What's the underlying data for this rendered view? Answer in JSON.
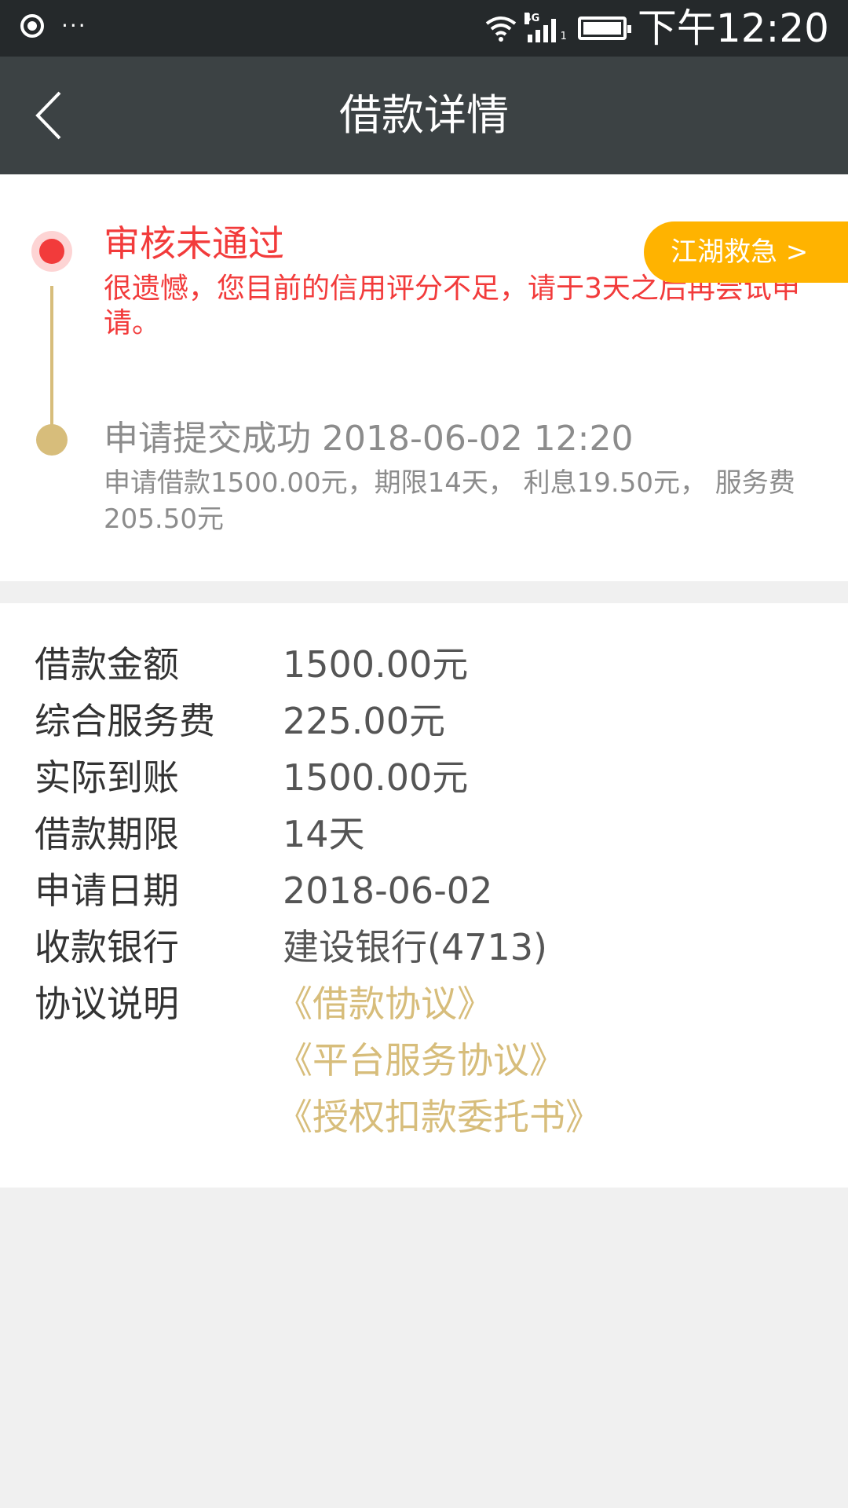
{
  "status_bar": {
    "time": "下午12:20",
    "network": "4G",
    "sim": "1",
    "more": "···",
    "icons": [
      "record-icon",
      "more-icon",
      "wifi-icon",
      "signal-icon",
      "battery-icon"
    ]
  },
  "header": {
    "title": "借款详情",
    "back_icon": "chevron-left-icon"
  },
  "timeline": {
    "steps": [
      {
        "title": "审核未通过",
        "desc": "很遗憾，您目前的信用评分不足，请于3天之后再尝试申请。",
        "color": "#f23b3b"
      },
      {
        "title": "申请提交成功 2018-06-02 12:20",
        "desc": "申请借款1500.00元，期限14天， 利息19.50元， 服务费205.50元",
        "color": "#8c8c8c"
      }
    ],
    "rescue_button": "江湖救急 >"
  },
  "details": {
    "rows": [
      {
        "label": "借款金额",
        "value": "1500.00元"
      },
      {
        "label": "综合服务费",
        "value": "225.00元"
      },
      {
        "label": "实际到账",
        "value": "1500.00元"
      },
      {
        "label": "借款期限",
        "value": "14天"
      },
      {
        "label": "申请日期",
        "value": "2018-06-02"
      },
      {
        "label": "收款银行",
        "value": "建设银行(4713)"
      }
    ],
    "agreement_label": "协议说明",
    "agreements": [
      "《借款协议》",
      "《平台服务协议》",
      "《授权扣款委托书》"
    ]
  },
  "colors": {
    "accent_gold": "#d7bd7b",
    "error_red": "#f23b3b",
    "button_orange": "#ffb300",
    "header_bg": "#3c4244"
  }
}
